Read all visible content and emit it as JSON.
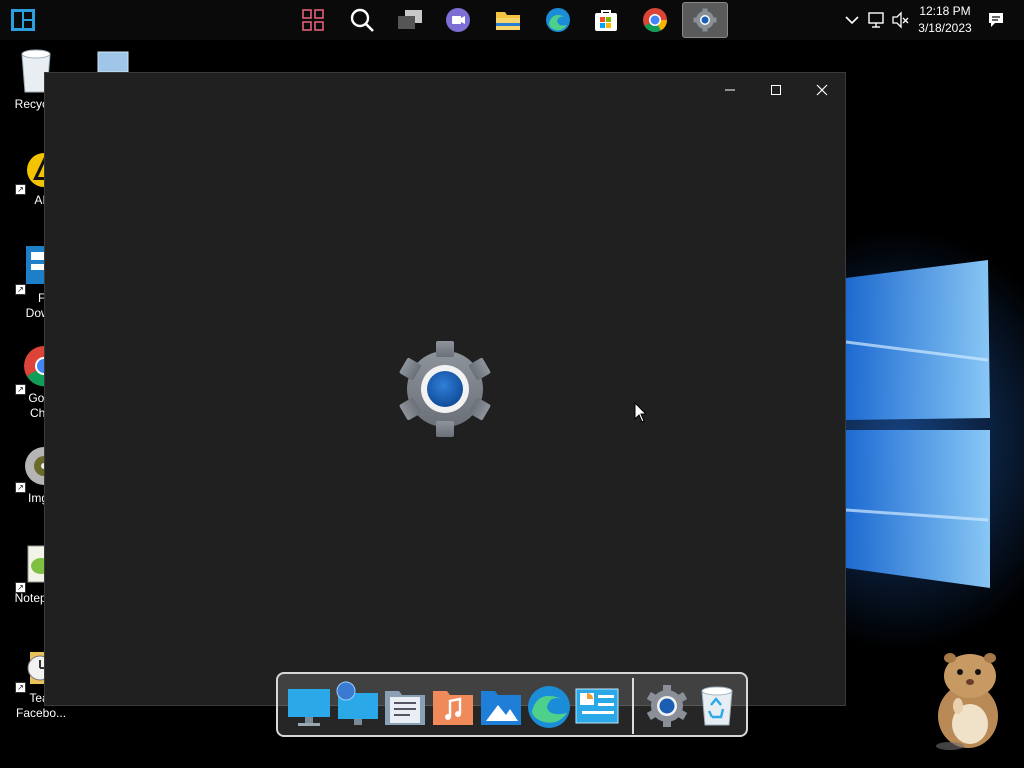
{
  "taskbar": {
    "pinned": [
      {
        "name": "widgets-icon",
        "active": false
      },
      {
        "name": "search-icon",
        "active": false
      },
      {
        "name": "task-view-icon",
        "active": false
      },
      {
        "name": "teams-chat-icon",
        "active": false
      },
      {
        "name": "file-explorer-icon",
        "active": false
      },
      {
        "name": "edge-icon",
        "active": false
      },
      {
        "name": "microsoft-store-icon",
        "active": false
      },
      {
        "name": "chrome-icon",
        "active": false
      },
      {
        "name": "settings-icon",
        "active": true
      }
    ],
    "clock": {
      "time": "12:18 PM",
      "date": "3/18/2023"
    }
  },
  "desktop": {
    "icons": [
      {
        "label": "Recycle",
        "icon": "recycle-bin-icon"
      },
      {
        "label": "AIM",
        "icon": "aim-icon"
      },
      {
        "label": "Fre",
        "label2": "Down",
        "icon": "free-download-manager-icon"
      },
      {
        "label": "Goog",
        "label2": "Chro",
        "icon": "chrome-icon"
      },
      {
        "label": "ImgB",
        "icon": "imgburn-icon"
      },
      {
        "label": "Notepa",
        "icon": "notepad-plus-icon"
      },
      {
        "label": "Team",
        "label2": "Facebo...",
        "icon": "clock-folder-icon"
      }
    ]
  },
  "window": {
    "app": "Settings",
    "controls": [
      "minimize",
      "maximize",
      "close"
    ]
  },
  "dock": {
    "items": [
      "this-pc-icon",
      "network-icon",
      "documents-icon",
      "music-folder-icon",
      "pictures-folder-icon",
      "edge-icon",
      "control-panel-icon",
      "settings-icon",
      "recycle-bin-icon"
    ]
  },
  "colors": {
    "window_bg": "#202020",
    "taskbar_bg": "#0a0a0a",
    "accent": "#1a5fb4"
  }
}
